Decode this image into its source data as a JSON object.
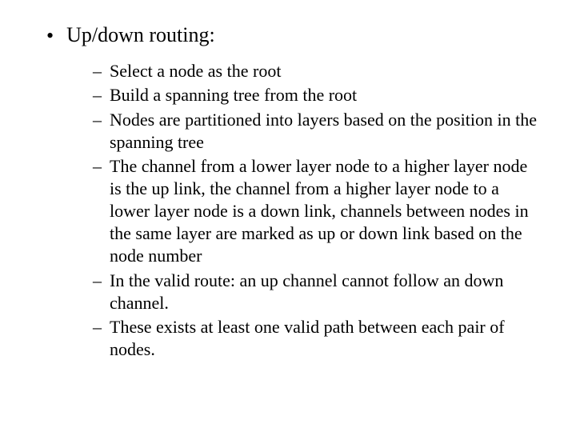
{
  "slide": {
    "main": "Up/down routing:",
    "subitems": [
      "Select a node as the root",
      "Build a spanning tree from the root",
      "Nodes are partitioned into layers based on the position in the spanning tree",
      "The channel from a lower layer node to a higher layer node is the up link, the channel from a higher layer node to a lower layer node is a down link, channels between nodes in the same layer are marked as up or down link based on the node number",
      "In the valid route: an up channel cannot follow an down channel.",
      "These exists at least one valid path between each pair of nodes."
    ]
  }
}
